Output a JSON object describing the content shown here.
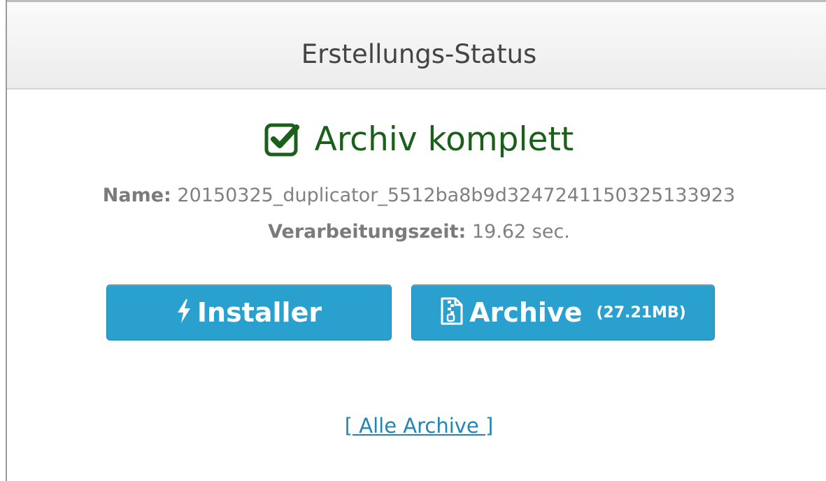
{
  "panel": {
    "title": "Erstellungs-Status"
  },
  "status": {
    "icon": "checkbox-checked-icon",
    "text": "Archiv komplett",
    "color": "#1a5f1a"
  },
  "info": {
    "name_label": "Name:",
    "name_value": "20150325_duplicator_5512ba8b9d3247241150325133923",
    "time_label": "Verarbeitungszeit:",
    "time_value": "19.62 sec."
  },
  "buttons": {
    "installer": {
      "icon": "bolt-icon",
      "label": "Installer"
    },
    "archive": {
      "icon": "file-zip-icon",
      "label": "Archive",
      "size": "(27.21MB)"
    },
    "color": "#2aa0cf"
  },
  "links": {
    "all_archives": "[ Alle Archive ]",
    "color": "#1f86b6"
  }
}
